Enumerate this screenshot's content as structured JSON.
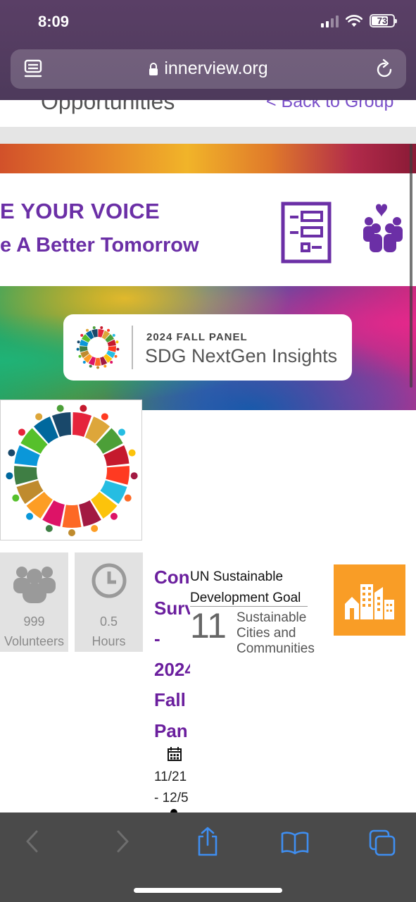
{
  "status_bar": {
    "time": "8:09",
    "battery": "73"
  },
  "browser": {
    "url": "innerview.org"
  },
  "page": {
    "section_title": "Opportunities",
    "back_link": "< Back to Group"
  },
  "banner": {
    "line1": "E YOUR VOICE",
    "line2": "e A Better Tomorrow",
    "panel_label": "2024 FALL PANEL",
    "panel_name": "SDG NextGen Insights"
  },
  "stats": [
    {
      "value": "999",
      "label": "Volunteers"
    },
    {
      "value": "0.5",
      "label": "Hours"
    }
  ],
  "opportunity": {
    "title_lines": [
      "Con",
      "Surv",
      "-",
      "2024",
      "Fall",
      "Pan"
    ],
    "date_lines": [
      "11/21",
      "- 12/5"
    ]
  },
  "sdg": {
    "title_line1": "UN Sustainable",
    "title_line2": "Development Goal",
    "number": "11",
    "name_lines": [
      "Sustainable",
      "Cities and",
      "Communities"
    ],
    "tile_color": "#f99d26"
  },
  "colors": {
    "brand_purple": "#6b1f9e",
    "toolbar_blue": "#3f8ef0"
  },
  "toolbar": [
    "back-icon",
    "forward-icon",
    "share-icon",
    "bookmarks-icon",
    "tabs-icon"
  ]
}
